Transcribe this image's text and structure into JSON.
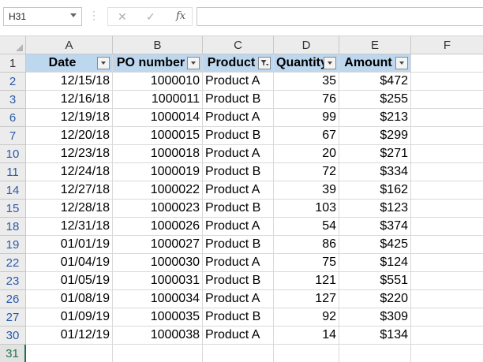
{
  "name_box": {
    "value": "H31"
  },
  "formula_bar": {
    "fx_label": "fx",
    "cancel_glyph": "✕",
    "enter_glyph": "✓",
    "content": ""
  },
  "columns": [
    "A",
    "B",
    "C",
    "D",
    "E",
    "F"
  ],
  "header": {
    "row_number": "1",
    "cells": [
      "Date",
      "PO number",
      "Product",
      "Quantity",
      "Amount"
    ],
    "filter_icons": [
      "dropdown-arrow",
      "dropdown-arrow",
      "filter-applied",
      "dropdown-arrow",
      "dropdown-arrow"
    ]
  },
  "rows": [
    {
      "num": "2",
      "date": "12/15/18",
      "po": "1000010",
      "product": "Product A",
      "qty": "35",
      "amount": "$472"
    },
    {
      "num": "3",
      "date": "12/16/18",
      "po": "1000011",
      "product": "Product B",
      "qty": "76",
      "amount": "$255"
    },
    {
      "num": "6",
      "date": "12/19/18",
      "po": "1000014",
      "product": "Product A",
      "qty": "99",
      "amount": "$213"
    },
    {
      "num": "7",
      "date": "12/20/18",
      "po": "1000015",
      "product": "Product B",
      "qty": "67",
      "amount": "$299"
    },
    {
      "num": "10",
      "date": "12/23/18",
      "po": "1000018",
      "product": "Product A",
      "qty": "20",
      "amount": "$271"
    },
    {
      "num": "11",
      "date": "12/24/18",
      "po": "1000019",
      "product": "Product B",
      "qty": "72",
      "amount": "$334"
    },
    {
      "num": "14",
      "date": "12/27/18",
      "po": "1000022",
      "product": "Product A",
      "qty": "39",
      "amount": "$162"
    },
    {
      "num": "15",
      "date": "12/28/18",
      "po": "1000023",
      "product": "Product B",
      "qty": "103",
      "amount": "$123"
    },
    {
      "num": "18",
      "date": "12/31/18",
      "po": "1000026",
      "product": "Product A",
      "qty": "54",
      "amount": "$374"
    },
    {
      "num": "19",
      "date": "01/01/19",
      "po": "1000027",
      "product": "Product B",
      "qty": "86",
      "amount": "$425"
    },
    {
      "num": "22",
      "date": "01/04/19",
      "po": "1000030",
      "product": "Product A",
      "qty": "75",
      "amount": "$124"
    },
    {
      "num": "23",
      "date": "01/05/19",
      "po": "1000031",
      "product": "Product B",
      "qty": "121",
      "amount": "$551"
    },
    {
      "num": "26",
      "date": "01/08/19",
      "po": "1000034",
      "product": "Product A",
      "qty": "127",
      "amount": "$220"
    },
    {
      "num": "27",
      "date": "01/09/19",
      "po": "1000035",
      "product": "Product B",
      "qty": "92",
      "amount": "$309"
    },
    {
      "num": "30",
      "date": "01/12/19",
      "po": "1000038",
      "product": "Product A",
      "qty": "14",
      "amount": "$134"
    }
  ],
  "last_row": {
    "num": "31"
  },
  "colors": {
    "header_fill": "#bdd7ee",
    "row_number_link": "#2a5aa8",
    "selection": "#217346"
  }
}
